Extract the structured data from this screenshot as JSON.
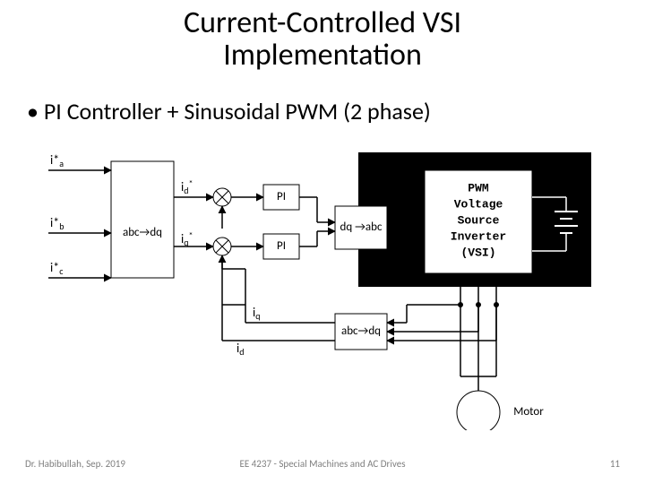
{
  "title_line1": "Current-Controlled VSI",
  "title_line2": "Implementation",
  "bullet": "PI Controller + Sinusoidal PWM (2 phase)",
  "signals": {
    "i_a_star": "i*",
    "i_a_sub": "a",
    "i_b_star": "i*",
    "i_b_sub": "b",
    "i_c_star": "i*",
    "i_c_sub": "c",
    "id_star": "i",
    "id_star_sub": "d",
    "id_star_sup": "*",
    "iq_star": "i",
    "iq_star_sub": "q",
    "iq_star_sup": "*",
    "iq": "i",
    "iq_sub": "q",
    "id": "i",
    "id_sub": "d"
  },
  "blocks": {
    "abc_to_dq": "abc→dq",
    "pi_top": "PI",
    "pi_bot": "PI",
    "dq_to_abc": "dq →abc",
    "vsi_l1": "PWM",
    "vsi_l2": "Voltage",
    "vsi_l3": "Source",
    "vsi_l4": "Inverter",
    "vsi_l5": "(VSI)",
    "fb_abc_to_dq": "abc→dq",
    "motor": "Motor"
  },
  "footer": {
    "left": "Dr. Habibullah, Sep. 2019",
    "center": "EE 4237 - Special Machines and AC Drives",
    "right": "11"
  }
}
